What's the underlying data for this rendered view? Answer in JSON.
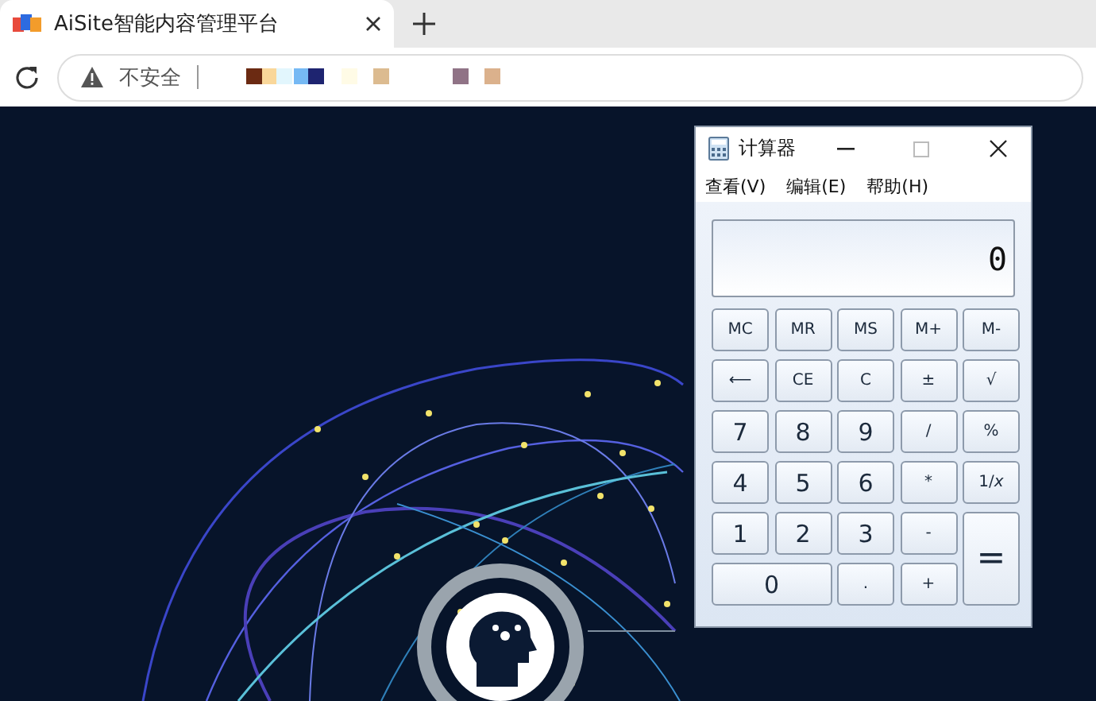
{
  "browser": {
    "tab": {
      "title": "AiSite智能内容管理平台",
      "selected": true
    },
    "address_bar": {
      "security_label": "不安全"
    }
  },
  "calculator": {
    "title": "计算器",
    "menu": [
      "查看(V)",
      "编辑(E)",
      "帮助(H)"
    ],
    "display": "0",
    "keys": [
      {
        "label": "MC",
        "kind": "function"
      },
      {
        "label": "MR",
        "kind": "function"
      },
      {
        "label": "MS",
        "kind": "function"
      },
      {
        "label": "M+",
        "kind": "function"
      },
      {
        "label": "M-",
        "kind": "function"
      },
      {
        "label": "⟵",
        "kind": "function"
      },
      {
        "label": "CE",
        "kind": "function"
      },
      {
        "label": "C",
        "kind": "function"
      },
      {
        "label": "±",
        "kind": "function"
      },
      {
        "label": "√",
        "kind": "function"
      },
      {
        "label": "7",
        "kind": "digit"
      },
      {
        "label": "8",
        "kind": "digit"
      },
      {
        "label": "9",
        "kind": "digit"
      },
      {
        "label": "/",
        "kind": "function"
      },
      {
        "label": "%",
        "kind": "function"
      },
      {
        "label": "4",
        "kind": "digit"
      },
      {
        "label": "5",
        "kind": "digit"
      },
      {
        "label": "6",
        "kind": "digit"
      },
      {
        "label": "*",
        "kind": "function"
      },
      {
        "label": "1/*x*",
        "kind": "function"
      },
      {
        "label": "1",
        "kind": "digit"
      },
      {
        "label": "2",
        "kind": "digit"
      },
      {
        "label": "3",
        "kind": "digit"
      },
      {
        "label": "-",
        "kind": "function"
      },
      {
        "label": "=",
        "kind": "tall"
      },
      {
        "label": "0",
        "kind": "wide"
      },
      {
        "label": ".",
        "kind": "function"
      },
      {
        "label": "+",
        "kind": "function"
      }
    ]
  }
}
